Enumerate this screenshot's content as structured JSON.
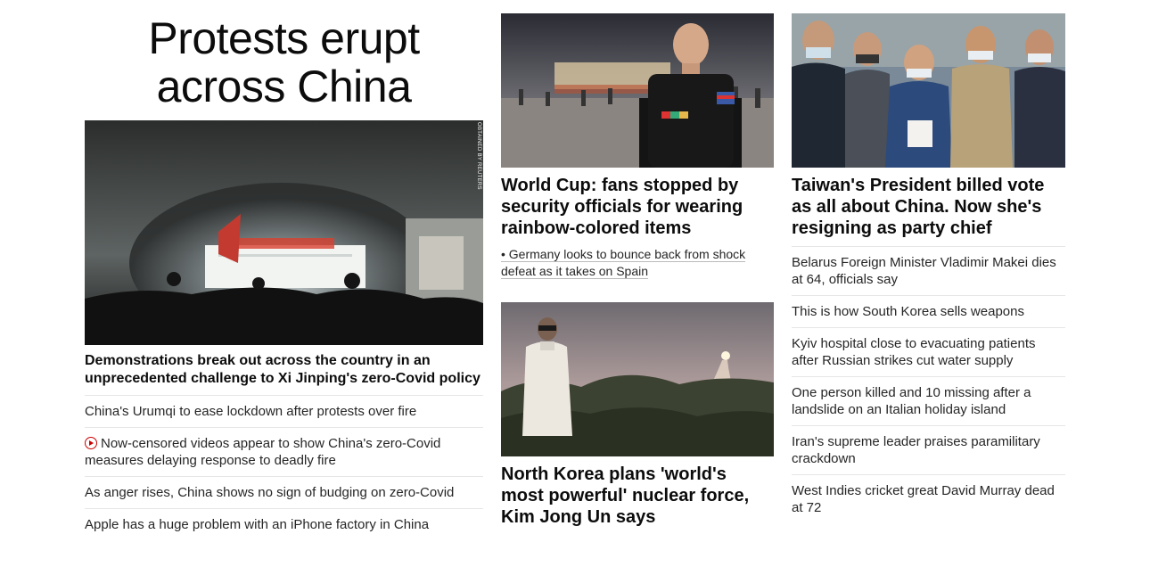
{
  "left": {
    "headline": "Protests erupt across China",
    "hero_credit": "OBTAINED BY REUTERS",
    "lead": "Demonstrations break out across the country in an unprecedented challenge to Xi Jinping's zero-Covid policy",
    "links": [
      {
        "text": "China's Urumqi to ease lockdown after protests over fire",
        "icon": ""
      },
      {
        "text": "Now-censored videos appear to show China's zero-Covid measures delaying response to deadly fire",
        "icon": "play-video-icon"
      },
      {
        "text": "As anger rises, China shows no sign of budging on zero-Covid",
        "icon": ""
      },
      {
        "text": "Apple has a huge problem with an iPhone factory in China",
        "icon": ""
      }
    ]
  },
  "middle": {
    "story1": {
      "headline": "World Cup: fans stopped by security officials for wearing rainbow-colored items",
      "bullet": "• Germany looks to bounce back from shock defeat as it takes on Spain"
    },
    "story2": {
      "headline": "North Korea plans 'world's most powerful' nuclear force, Kim Jong Un says"
    }
  },
  "right": {
    "headline": "Taiwan's President billed vote as all about China. Now she's resigning as party chief",
    "links": [
      "Belarus Foreign Minister Vladimir Makei dies at 64, officials say",
      "This is how South Korea sells weapons",
      "Kyiv hospital close to evacuating patients after Russian strikes cut water supply",
      "One person killed and 10 missing after a landslide on an Italian holiday island",
      "Iran's supreme leader praises paramilitary crackdown",
      "West Indies cricket great David Murray dead at 72"
    ]
  },
  "colors": {
    "accent_red": "#cc0000",
    "text": "#0c0c0c",
    "divider": "#e6e6e6"
  }
}
